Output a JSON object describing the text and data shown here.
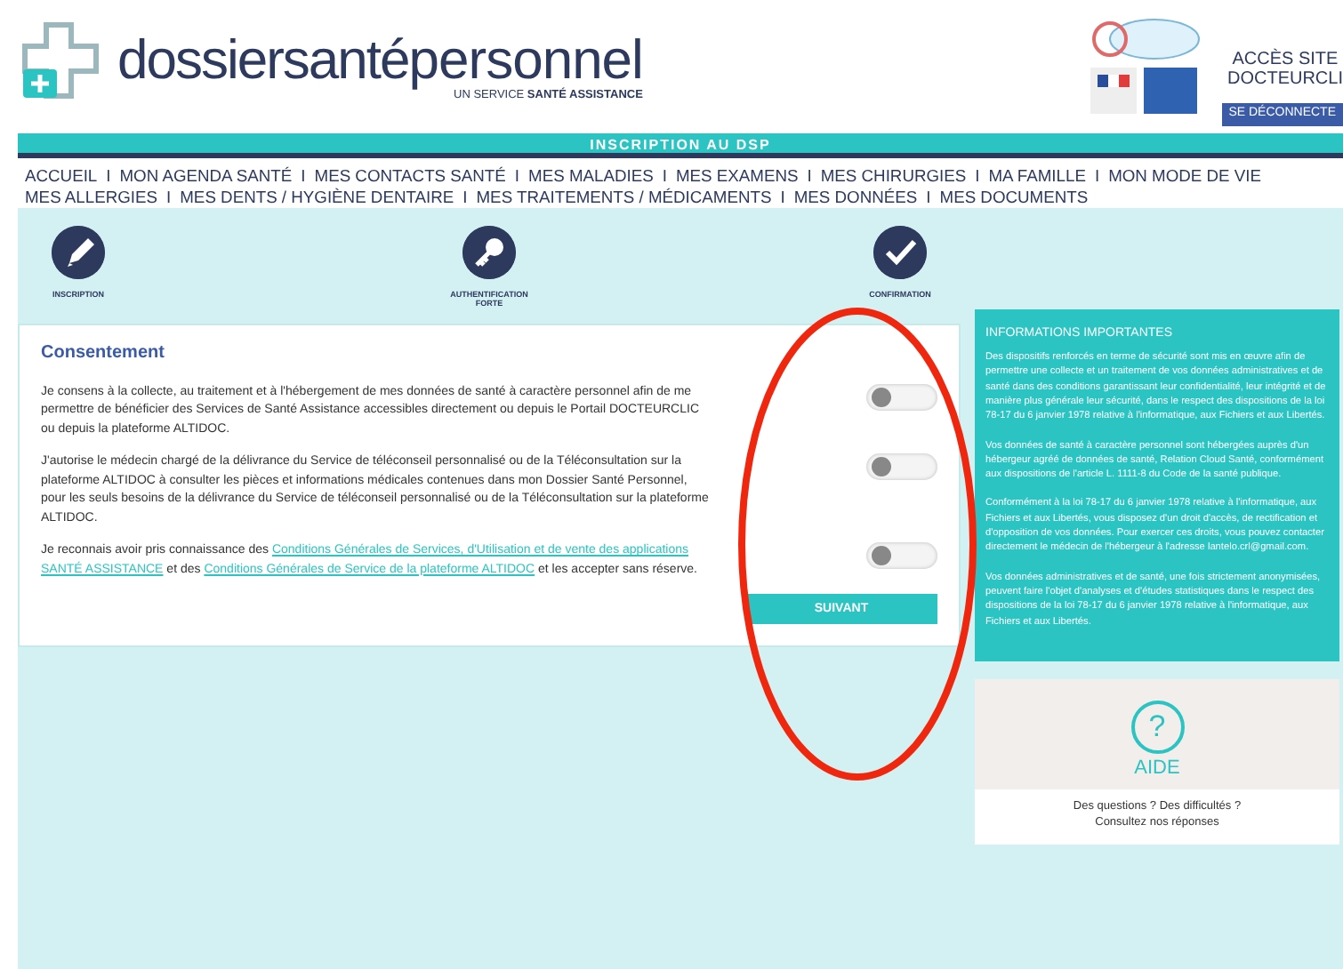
{
  "header": {
    "logo": {
      "part_1": "dossiersanté",
      "part_2": "personnel",
      "tagline": "UN SERVICE **SANTÉ ASSISTANCE**"
    },
    "site_link": [
      "ACCÈS SITE",
      "DOCTEURCLI"
    ],
    "logout_button": "SE DÉCONNECTE"
  },
  "title_bar": "INSCRIPTION AU DSP",
  "nav": {
    "items": [
      {
        "kind": "link",
        "text": "ACCUEIL"
      },
      {
        "kind": "separator",
        "text": "I"
      },
      {
        "kind": "link",
        "text": "MON AGENDA SANTÉ"
      },
      {
        "kind": "separator",
        "text": "I"
      },
      {
        "kind": "link",
        "text": "MES CONTACTS SANTÉ"
      },
      {
        "kind": "separator",
        "text": "I"
      },
      {
        "kind": "link",
        "text": "MES MALADIES"
      },
      {
        "kind": "separator",
        "text": "I"
      },
      {
        "kind": "link",
        "text": "MES EXAMENS"
      },
      {
        "kind": "separator",
        "text": "I"
      },
      {
        "kind": "link",
        "text": "MES CHIRURGIES"
      },
      {
        "kind": "separator",
        "text": "I"
      },
      {
        "kind": "link",
        "text": "MA FAMILLE"
      },
      {
        "kind": "separator",
        "text": "I"
      },
      {
        "kind": "link",
        "text": "MON MODE DE VIE"
      },
      {
        "kind": "link",
        "text": "MES ALLERGIES"
      },
      {
        "kind": "separator",
        "text": "I"
      },
      {
        "kind": "link",
        "text": "MES DENTS / HYGIÈNE DENTAIRE"
      },
      {
        "kind": "separator",
        "text": "I"
      },
      {
        "kind": "link",
        "text": "MES TRAITEMENTS / MÉDICAMENTS"
      },
      {
        "kind": "separator",
        "text": "I"
      },
      {
        "kind": "link",
        "text": "MES DONNÉES"
      },
      {
        "kind": "separator",
        "text": "I"
      },
      {
        "kind": "link",
        "text": "MES DOCUMENTS"
      }
    ]
  },
  "steps": [
    {
      "kind": "pencil",
      "label": "INSCRIPTION"
    },
    {
      "kind": "key",
      "label": "AUTHENTIFICATION FORTE"
    },
    {
      "kind": "check",
      "label": "CONFIRMATION"
    }
  ],
  "consent": {
    "title": "Consentement",
    "items": [
      {
        "on": false,
        "parts": [
          {
            "kind": "text",
            "text": "Je consens à la collecte, au traitement et à l'hébergement de mes données de santé à caractère personnel afin de me permettre de bénéficier des Services de Santé Assistance accessibles directement ou depuis le Portail DOCTEURCLIC ou depuis la plateforme ALTIDOC."
          }
        ]
      },
      {
        "on": false,
        "parts": [
          {
            "kind": "text",
            "text": "J'autorise le médecin chargé de la délivrance du Service de téléconseil personnalisé ou de la Téléconsultation sur la plateforme ALTIDOC à consulter les pièces et informations médicales contenues dans mon Dossier Santé Personnel, pour les seuls besoins de la délivrance du Service de téléconseil personnalisé ou de la Téléconsultation sur la plateforme ALTIDOC."
          }
        ]
      },
      {
        "on": false,
        "parts": [
          {
            "kind": "text",
            "text": "Je reconnais avoir pris connaissance des "
          },
          {
            "kind": "link",
            "text": "Conditions Générales de Services, d'Utilisation et de vente des applications"
          },
          {
            "kind": "link",
            "text": "SANTÉ ASSISTANCE"
          },
          {
            "kind": "text",
            "text": " et des "
          },
          {
            "kind": "link",
            "text": "Conditions Générales de Service de la plateforme ALTIDOC"
          },
          {
            "kind": "text",
            "text": " et les accepter sans réserve."
          }
        ]
      }
    ],
    "button": "SUIVANT"
  },
  "info": {
    "title": "INFORMATIONS IMPORTANTES",
    "paragraphs": [
      "Des dispositifs renforcés en terme de sécurité sont mis en œuvre afin de permettre une collecte et un traitement de vos données administratives et de santé dans des conditions garantissant leur confidentialité, leur intégrité et de manière plus générale leur sécurité, dans le respect des dispositions de la loi 78-17 du 6 janvier 1978 relative à l'informatique, aux Fichiers et aux Libertés.",
      "Vos données de santé à caractère personnel sont hébergées auprès d'un hébergeur agréé de données de santé, Relation Cloud Santé, conformément aux dispositions de l'article L. 1111-8 du Code de la santé publique.",
      "Conformément à la loi 78-17 du 6 janvier 1978 relative à l'informatique, aux Fichiers et aux Libertés, vous disposez d'un droit d'accès, de rectification et d'opposition de vos données. Pour exercer ces droits, vous pouvez contacter directement le médecin de l'hébergeur à l'adresse lantelo.crl@gmail.com.",
      "Vos données administratives et de santé, une fois strictement anonymisées, peuvent faire l'objet d'analyses et d'études statistiques dans le respect des dispositions de la loi 78-17 du 6 janvier 1978 relative à l'informatique, aux Fichiers et aux Libertés."
    ]
  },
  "help": {
    "icon": "?",
    "title": "AIDE",
    "lines": [
      "Des questions ? Des difficultés ?",
      "Consultez nos réponses"
    ]
  }
}
